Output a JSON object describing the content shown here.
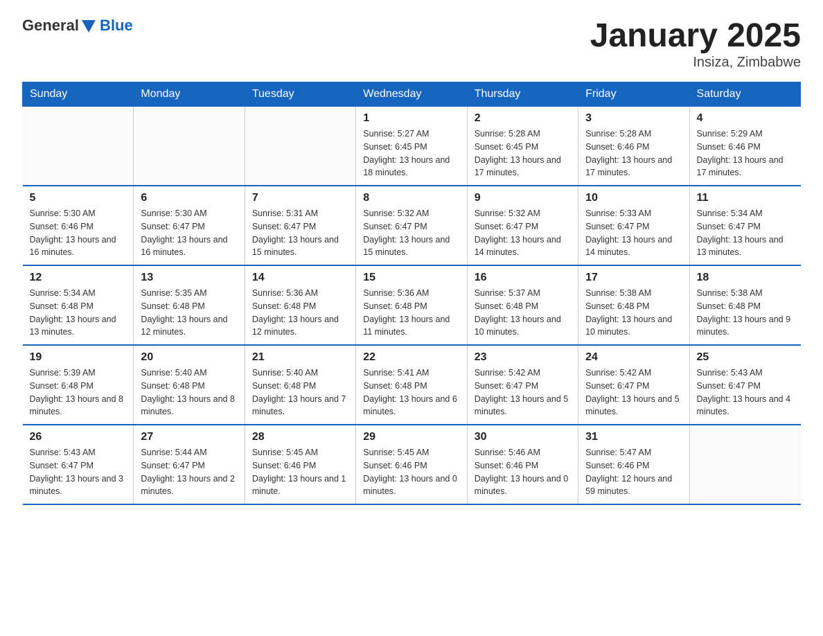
{
  "logo": {
    "general": "General",
    "blue": "Blue"
  },
  "title": "January 2025",
  "subtitle": "Insiza, Zimbabwe",
  "days_of_week": [
    "Sunday",
    "Monday",
    "Tuesday",
    "Wednesday",
    "Thursday",
    "Friday",
    "Saturday"
  ],
  "weeks": [
    [
      {
        "day": "",
        "info": ""
      },
      {
        "day": "",
        "info": ""
      },
      {
        "day": "",
        "info": ""
      },
      {
        "day": "1",
        "info": "Sunrise: 5:27 AM\nSunset: 6:45 PM\nDaylight: 13 hours and 18 minutes."
      },
      {
        "day": "2",
        "info": "Sunrise: 5:28 AM\nSunset: 6:45 PM\nDaylight: 13 hours and 17 minutes."
      },
      {
        "day": "3",
        "info": "Sunrise: 5:28 AM\nSunset: 6:46 PM\nDaylight: 13 hours and 17 minutes."
      },
      {
        "day": "4",
        "info": "Sunrise: 5:29 AM\nSunset: 6:46 PM\nDaylight: 13 hours and 17 minutes."
      }
    ],
    [
      {
        "day": "5",
        "info": "Sunrise: 5:30 AM\nSunset: 6:46 PM\nDaylight: 13 hours and 16 minutes."
      },
      {
        "day": "6",
        "info": "Sunrise: 5:30 AM\nSunset: 6:47 PM\nDaylight: 13 hours and 16 minutes."
      },
      {
        "day": "7",
        "info": "Sunrise: 5:31 AM\nSunset: 6:47 PM\nDaylight: 13 hours and 15 minutes."
      },
      {
        "day": "8",
        "info": "Sunrise: 5:32 AM\nSunset: 6:47 PM\nDaylight: 13 hours and 15 minutes."
      },
      {
        "day": "9",
        "info": "Sunrise: 5:32 AM\nSunset: 6:47 PM\nDaylight: 13 hours and 14 minutes."
      },
      {
        "day": "10",
        "info": "Sunrise: 5:33 AM\nSunset: 6:47 PM\nDaylight: 13 hours and 14 minutes."
      },
      {
        "day": "11",
        "info": "Sunrise: 5:34 AM\nSunset: 6:47 PM\nDaylight: 13 hours and 13 minutes."
      }
    ],
    [
      {
        "day": "12",
        "info": "Sunrise: 5:34 AM\nSunset: 6:48 PM\nDaylight: 13 hours and 13 minutes."
      },
      {
        "day": "13",
        "info": "Sunrise: 5:35 AM\nSunset: 6:48 PM\nDaylight: 13 hours and 12 minutes."
      },
      {
        "day": "14",
        "info": "Sunrise: 5:36 AM\nSunset: 6:48 PM\nDaylight: 13 hours and 12 minutes."
      },
      {
        "day": "15",
        "info": "Sunrise: 5:36 AM\nSunset: 6:48 PM\nDaylight: 13 hours and 11 minutes."
      },
      {
        "day": "16",
        "info": "Sunrise: 5:37 AM\nSunset: 6:48 PM\nDaylight: 13 hours and 10 minutes."
      },
      {
        "day": "17",
        "info": "Sunrise: 5:38 AM\nSunset: 6:48 PM\nDaylight: 13 hours and 10 minutes."
      },
      {
        "day": "18",
        "info": "Sunrise: 5:38 AM\nSunset: 6:48 PM\nDaylight: 13 hours and 9 minutes."
      }
    ],
    [
      {
        "day": "19",
        "info": "Sunrise: 5:39 AM\nSunset: 6:48 PM\nDaylight: 13 hours and 8 minutes."
      },
      {
        "day": "20",
        "info": "Sunrise: 5:40 AM\nSunset: 6:48 PM\nDaylight: 13 hours and 8 minutes."
      },
      {
        "day": "21",
        "info": "Sunrise: 5:40 AM\nSunset: 6:48 PM\nDaylight: 13 hours and 7 minutes."
      },
      {
        "day": "22",
        "info": "Sunrise: 5:41 AM\nSunset: 6:48 PM\nDaylight: 13 hours and 6 minutes."
      },
      {
        "day": "23",
        "info": "Sunrise: 5:42 AM\nSunset: 6:47 PM\nDaylight: 13 hours and 5 minutes."
      },
      {
        "day": "24",
        "info": "Sunrise: 5:42 AM\nSunset: 6:47 PM\nDaylight: 13 hours and 5 minutes."
      },
      {
        "day": "25",
        "info": "Sunrise: 5:43 AM\nSunset: 6:47 PM\nDaylight: 13 hours and 4 minutes."
      }
    ],
    [
      {
        "day": "26",
        "info": "Sunrise: 5:43 AM\nSunset: 6:47 PM\nDaylight: 13 hours and 3 minutes."
      },
      {
        "day": "27",
        "info": "Sunrise: 5:44 AM\nSunset: 6:47 PM\nDaylight: 13 hours and 2 minutes."
      },
      {
        "day": "28",
        "info": "Sunrise: 5:45 AM\nSunset: 6:46 PM\nDaylight: 13 hours and 1 minute."
      },
      {
        "day": "29",
        "info": "Sunrise: 5:45 AM\nSunset: 6:46 PM\nDaylight: 13 hours and 0 minutes."
      },
      {
        "day": "30",
        "info": "Sunrise: 5:46 AM\nSunset: 6:46 PM\nDaylight: 13 hours and 0 minutes."
      },
      {
        "day": "31",
        "info": "Sunrise: 5:47 AM\nSunset: 6:46 PM\nDaylight: 12 hours and 59 minutes."
      },
      {
        "day": "",
        "info": ""
      }
    ]
  ]
}
